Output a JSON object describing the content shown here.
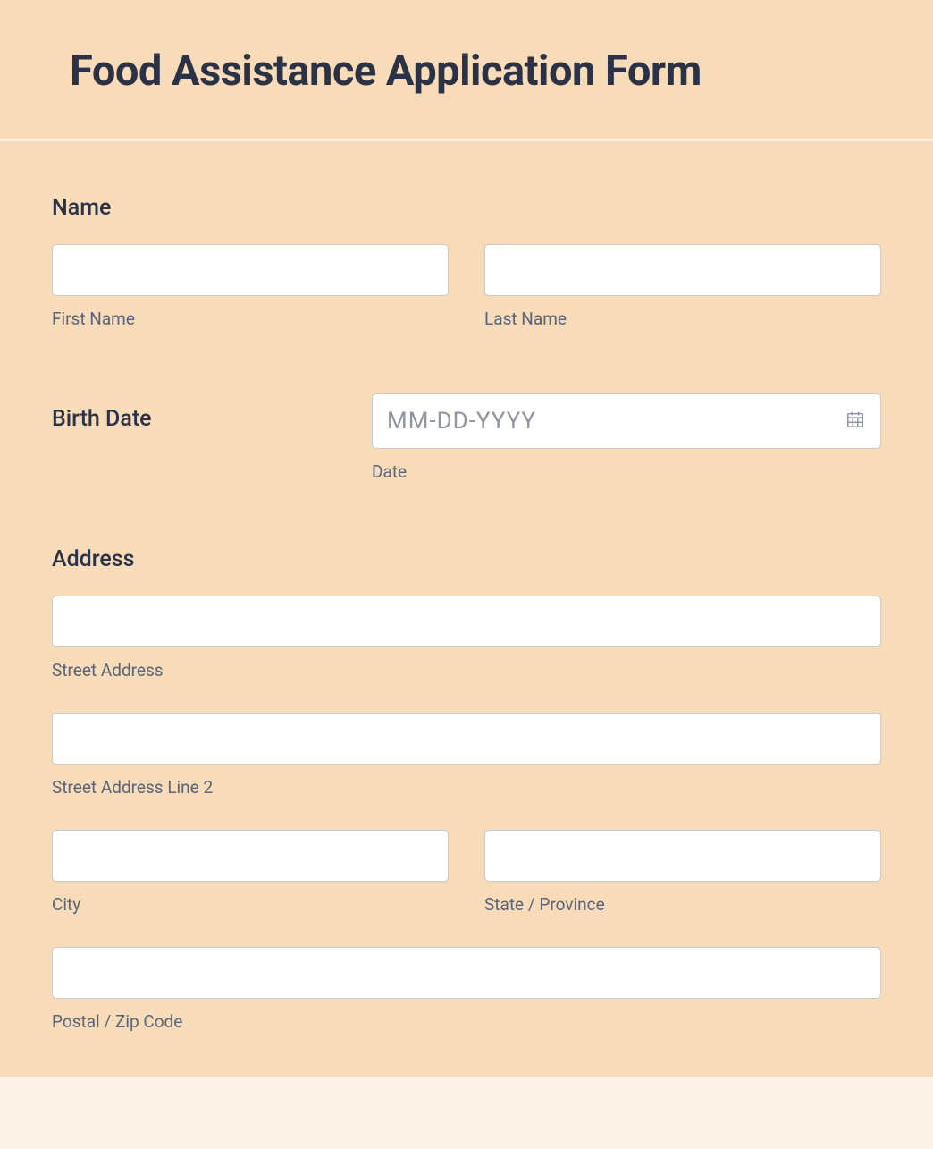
{
  "header": {
    "title": "Food Assistance Application Form"
  },
  "name": {
    "label": "Name",
    "first_sub": "First Name",
    "last_sub": "Last Name"
  },
  "birthdate": {
    "label": "Birth Date",
    "placeholder": "MM-DD-YYYY",
    "sub": "Date"
  },
  "address": {
    "label": "Address",
    "street_sub": "Street Address",
    "street2_sub": "Street Address Line 2",
    "city_sub": "City",
    "state_sub": "State / Province",
    "postal_sub": "Postal / Zip Code"
  }
}
